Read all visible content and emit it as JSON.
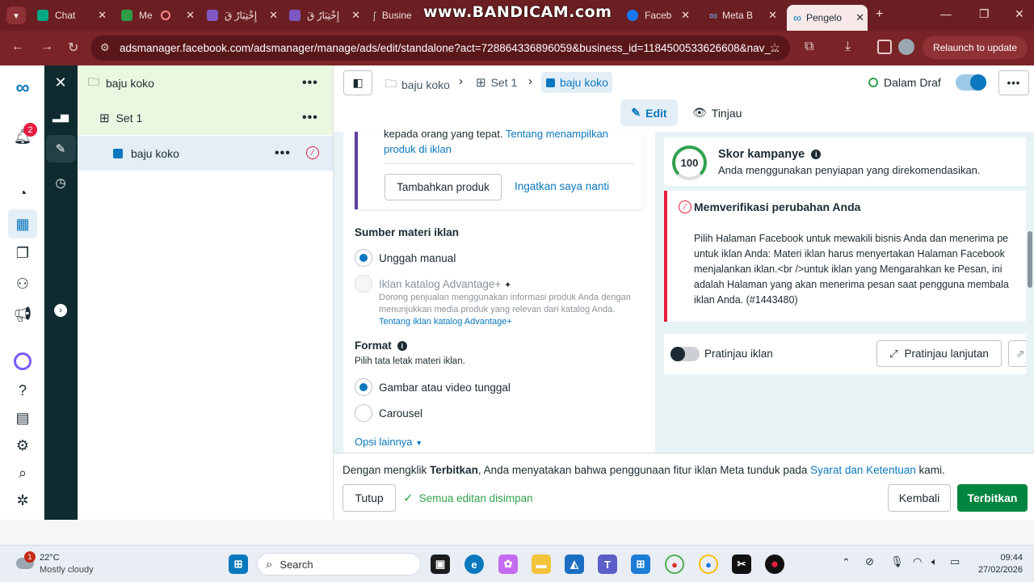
{
  "browser": {
    "tabs": [
      {
        "label": "Chat",
        "color": "#00a884"
      },
      {
        "label": "Me",
        "color": "#2e9c48"
      },
      {
        "label": "إِخْتِبَارٌ قَ",
        "color": "#673ab7"
      },
      {
        "label": "إِخْتِبَارٌ قَ",
        "color": "#673ab7"
      },
      {
        "label": "Busine",
        "color": "#555555"
      },
      {
        "label": "Faceb",
        "color": "#1877f2"
      },
      {
        "label": "Meta B",
        "color": "#0a78be"
      },
      {
        "label": "Pengelo",
        "color": "#0a78be"
      }
    ],
    "watermark": "www.BANDICAM.com",
    "url": "adsmanager.facebook.com/adsmanager/manage/ads/edit/standalone?act=728864336896059&business_id=1184500533626608&nav_...",
    "relaunch": "Relaunch to update"
  },
  "rail": {
    "notif_count": "2"
  },
  "tree": {
    "campaign": "baju koko",
    "adset": "Set 1",
    "ad": "baju koko"
  },
  "header": {
    "crumbs": [
      "baju koko",
      "Set 1",
      "baju koko"
    ],
    "status": "Dalam Draf",
    "edit": "Edit",
    "review": "Tinjau"
  },
  "catalog": {
    "text_a": "kepada orang yang tepat.",
    "link_a": "Tentang menampilkan",
    "link_b": "produk di iklan",
    "add_product": "Tambahkan produk",
    "remind_later": "Ingatkan saya nanti"
  },
  "source": {
    "title": "Sumber materi iklan",
    "manual": "Unggah manual",
    "catalog_title": "Iklan katalog Advantage+",
    "catalog_desc": "Dorong penjualan menggunakan informasi produk Anda dengan menunjukkan media produk yang relevan dari katalog Anda.",
    "catalog_link": "Tentang iklan katalog Advantage+"
  },
  "format": {
    "title": "Format",
    "subtitle": "Pilih tata letak materi iklan.",
    "single": "Gambar atau video tunggal",
    "carousel": "Carousel",
    "more": "Opsi lainnya"
  },
  "score": {
    "value": "100",
    "title": "Skor kampanye",
    "desc": "Anda menggunakan penyiapan yang direkomendasikan."
  },
  "error": {
    "title": "Memverifikasi perubahan Anda",
    "lines": [
      "Pilih Halaman Facebook untuk mewakili bisnis Anda dan menerima pe",
      "untuk iklan Anda: Materi iklan harus menyertakan Halaman Facebook",
      "menjalankan iklan.<br />untuk iklan yang Mengarahkan ke Pesan, ini",
      "adalah Halaman yang akan menerima pesan saat pengguna membala",
      "iklan Anda. (#1443480)"
    ]
  },
  "preview": {
    "toggle_label": "Pratinjau iklan",
    "advanced": "Pratinjau lanjutan"
  },
  "footer": {
    "terms_pre": "Dengan mengklik ",
    "terms_bold": "Terbitkan",
    "terms_mid": ", Anda menyatakan bahwa penggunaan fitur iklan Meta tunduk pada ",
    "terms_link": "Syarat dan Ketentuan",
    "terms_post": " kami.",
    "close": "Tutup",
    "saved": "Semua editan disimpan",
    "back": "Kembali",
    "publish": "Terbitkan"
  },
  "taskbar": {
    "weather_badge": "1",
    "temp": "22°C",
    "weather": "Mostly cloudy",
    "search": "Search",
    "time": "09:44",
    "date": "27/02/2026"
  }
}
